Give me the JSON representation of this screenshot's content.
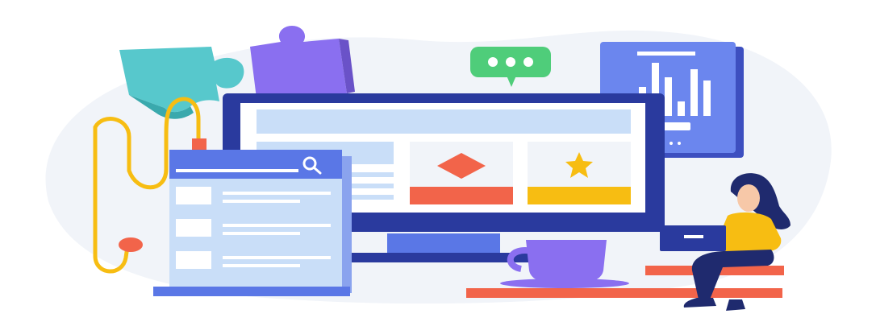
{
  "illustration": {
    "subject": "web-development-flat-illustration",
    "icons": [
      "puzzle-icon",
      "chat-bubble-icon",
      "bar-chart-icon",
      "search-icon",
      "diamond-icon",
      "star-icon",
      "coffee-cup-icon",
      "laptop-icon"
    ],
    "colors": {
      "background_blob": "#f1f4f9",
      "monitor_frame": "#2a3a9e",
      "monitor_screen": "#ffffff",
      "screen_bar": "#c9def8",
      "accent_blue": "#5a77e6",
      "accent_red": "#f2644a",
      "accent_yellow": "#f7bd12",
      "accent_teal": "#57c8cc",
      "accent_purple": "#8a6ff0",
      "accent_green": "#4fcd7a",
      "shelf_red": "#f2644a",
      "doc_panel": "#c9def8"
    }
  }
}
